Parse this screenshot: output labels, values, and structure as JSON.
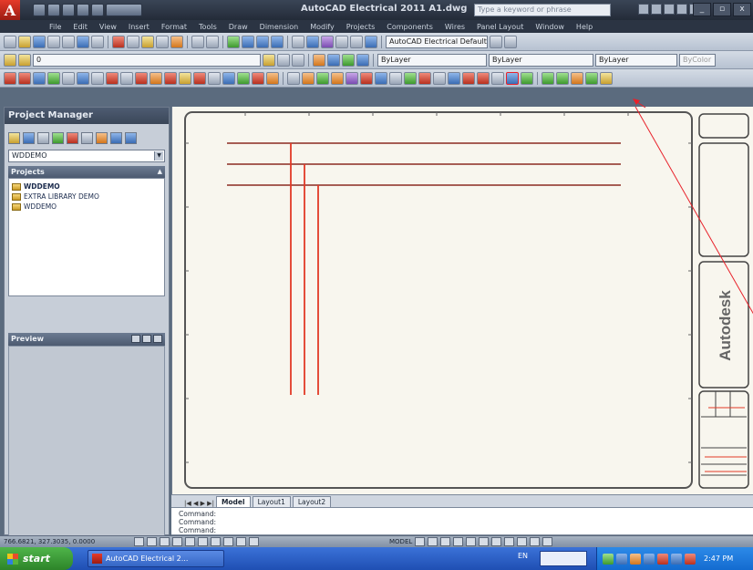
{
  "app": {
    "title": "AutoCAD Electrical 2011   A1.dwg",
    "search_placeholder": "Type a keyword or phrase"
  },
  "window_controls": [
    "_",
    "▫",
    "x"
  ],
  "menu": {
    "items": [
      "File",
      "Edit",
      "View",
      "Insert",
      "Format",
      "Tools",
      "Draw",
      "Dimension",
      "Modify",
      "Projects",
      "Components",
      "Wires",
      "Panel Layout",
      "Window",
      "Help"
    ]
  },
  "toolbar_standard": {
    "workspace": "AutoCAD Electrical Default"
  },
  "toolbar_layers": {
    "layer_name": "0",
    "color": "ByLayer",
    "linetype": "ByLayer",
    "lineweight": "ByLayer",
    "plotstyle": "ByColor"
  },
  "project_manager": {
    "title": "Project Manager",
    "project_select": "WDDEMO",
    "projects_header": "Projects",
    "projects": [
      "WDDEMO",
      "EXTRA LIBRARY DEMO",
      "WDDEMO"
    ],
    "preview_header": "Preview"
  },
  "drawing": {
    "title_block_logo": "Autodesk",
    "h_lines": 3,
    "v_lines": 3
  },
  "layout_tabs": {
    "nav": "|◀ ◀ ▶ ▶|",
    "tabs": [
      "Model",
      "Layout1",
      "Layout2"
    ]
  },
  "command_line": {
    "lines": [
      "Command:",
      "Command:",
      "Command:"
    ]
  },
  "status_bar": {
    "coords": "766.6821, 327.3035, 0.0000",
    "model": "MODEL"
  },
  "taskbar": {
    "start": "start",
    "task": "AutoCAD Electrical 2...",
    "lang": "EN",
    "clock": "2:47 PM"
  },
  "colors": {
    "drawing_bg": "#f8f6ee",
    "wire": "#e23a26",
    "annotation": "#e8212a",
    "title_bar": "#232b38"
  }
}
